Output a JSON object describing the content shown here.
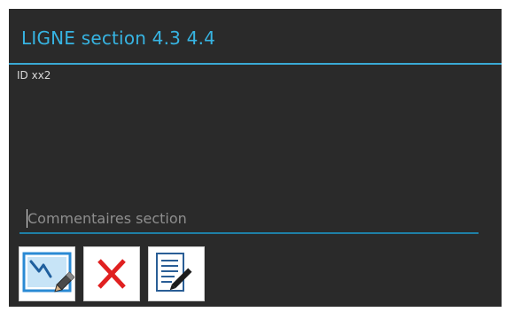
{
  "dialog": {
    "title": "LIGNE section 4.3 4.4",
    "id_label": "ID xx2"
  },
  "comment": {
    "placeholder": "Commentaires section",
    "value": ""
  },
  "actions": [
    {
      "name": "draw",
      "icon": "pen-drawing-icon"
    },
    {
      "name": "cancel",
      "icon": "red-x-icon",
      "color": "#e02020"
    },
    {
      "name": "edit-notes",
      "icon": "document-edit-icon"
    }
  ],
  "colors": {
    "dialog_bg": "#2a2a2a",
    "accent": "#37b4e2",
    "divider": "#3aa9d5",
    "field_underline": "#1e7fa6"
  }
}
